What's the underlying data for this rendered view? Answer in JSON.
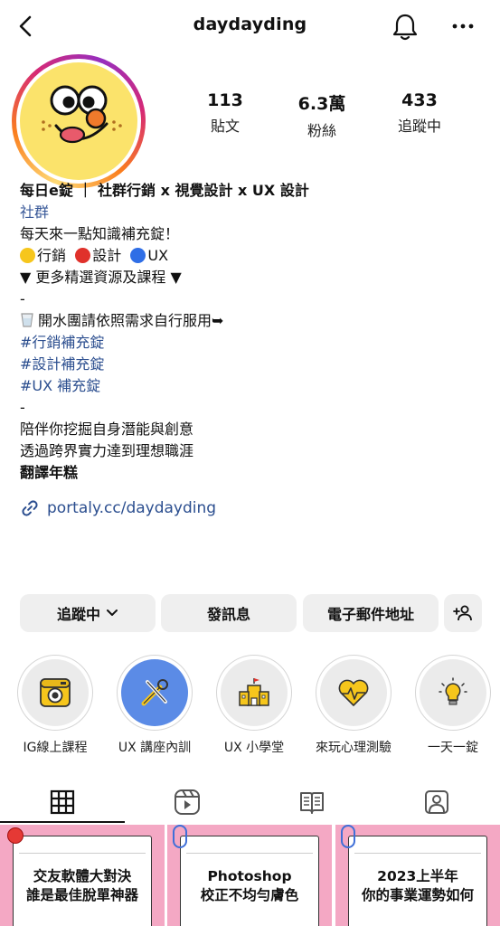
{
  "header": {
    "username": "daydayding",
    "icons": [
      "back-arrow-icon",
      "bell-icon",
      "more-icon"
    ]
  },
  "profile": {
    "avatar": "cartoon-face-avatar",
    "stats": [
      {
        "value": "113",
        "label": "貼文"
      },
      {
        "value": "6.3萬",
        "label": "粉絲"
      },
      {
        "value": "433",
        "label": "追蹤中"
      }
    ],
    "bio": {
      "name": "每日e錠 ｜ 社群行銷 x 視覺設計 x UX 設計",
      "category": "社群",
      "line1": "每天來一點知識補充錠！",
      "pill1": "行銷",
      "pill2": "設計",
      "pill3": "UX",
      "line3": "▼ 更多精選資源及課程 ▼",
      "dash1": "-",
      "line4": "開水團請依照需求自行服用➥",
      "hashtag1": "#行銷補充錠",
      "hashtag2": "#設計補充錠",
      "hashtag3": "#UX 補充錠",
      "dash2": "-",
      "line5": "陪伴你挖掘自身潛能與創意",
      "line6": "透過跨界實力達到理想職涯",
      "line7": "翻譯年糕",
      "colors": {
        "yellow": "#f6c61c",
        "red": "#e0312b",
        "blue": "#2f6ee6"
      }
    },
    "link": "portaly.cc/daydayding"
  },
  "actions": {
    "following": "追蹤中",
    "message": "發訊息",
    "email": "電子郵件地址"
  },
  "highlights": [
    {
      "label": "IG線上課程",
      "icon": "camera-icon"
    },
    {
      "label": "UX 講座內訓",
      "icon": "tools-icon"
    },
    {
      "label": "UX 小學堂",
      "icon": "school-icon"
    },
    {
      "label": "來玩心理測驗",
      "icon": "heart-pulse-icon"
    },
    {
      "label": "一天一錠",
      "icon": "lightbulb-icon"
    }
  ],
  "tabs": [
    "grid-icon",
    "reels-icon",
    "guide-icon",
    "tagged-icon"
  ],
  "posts": [
    {
      "title_line1": "交友軟體大對決",
      "title_line2": "誰是最佳脫單神器"
    },
    {
      "title_line1": "Photoshop",
      "title_line2": "校正不均勻膚色"
    },
    {
      "title_line1": "2023上半年",
      "title_line2": "你的事業運勢如何"
    }
  ],
  "theme": {
    "link_color": "#2b4e8f",
    "button_bg": "#efefef",
    "post_bg": "#f4a8c4"
  }
}
